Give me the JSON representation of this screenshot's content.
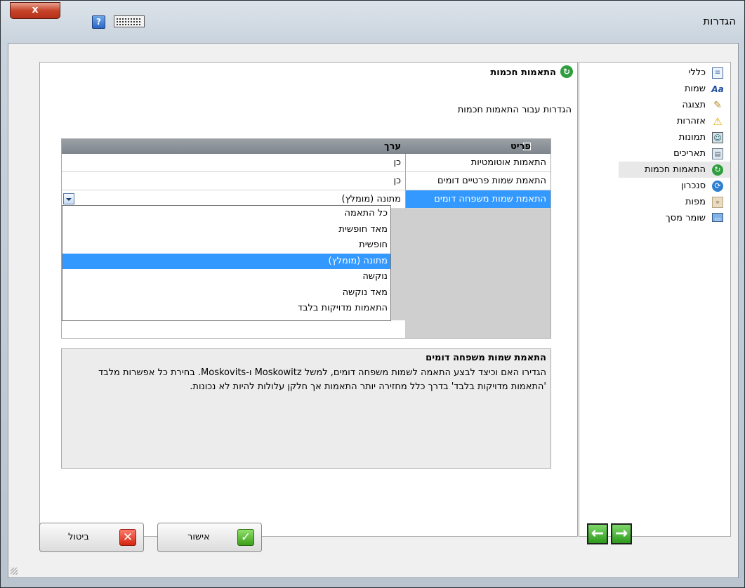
{
  "window": {
    "title": "הגדרות",
    "close_label": "x",
    "help_label": "?"
  },
  "nav": {
    "items": [
      {
        "label": "כללי",
        "icon": "document-list-icon"
      },
      {
        "label": "שמות",
        "icon": "font-aa-icon"
      },
      {
        "label": "תצוגה",
        "icon": "brush-icon"
      },
      {
        "label": "אזהרות",
        "icon": "warning-icon"
      },
      {
        "label": "תמונות",
        "icon": "picture-icon"
      },
      {
        "label": "תאריכים",
        "icon": "calendar-icon"
      },
      {
        "label": "התאמות חכמות",
        "icon": "smart-match-icon",
        "active": true
      },
      {
        "label": "סנכרון",
        "icon": "sync-icon"
      },
      {
        "label": "מפות",
        "icon": "map-icon"
      },
      {
        "label": "שומר מסך",
        "icon": "monitor-icon"
      }
    ]
  },
  "main": {
    "title": "התאמות חכמות",
    "subtitle": "הגדרות עבור התאמות חכמות",
    "grid": {
      "col_property": "פריט",
      "col_value": "ערך",
      "rows": [
        {
          "property": "התאמות אוטומטיות",
          "value": "כן"
        },
        {
          "property": "התאמת שמות פרטיים דומים",
          "value": "כן"
        },
        {
          "property": "התאמת שמות משפחה דומים",
          "value": "מתונה (מומלץ)"
        }
      ],
      "dropdown_options": [
        "כל התאמה",
        "מאד חופשית",
        "חופשית",
        "מתונה (מומלץ)",
        "נוקשה",
        "מאד נוקשה",
        "התאמות מדויקות בלבד"
      ],
      "selected_option": "מתונה (מומלץ)"
    },
    "description": {
      "title": "התאמת שמות משפחה דומים",
      "body": "הגדירו האם וכיצד לבצע התאמה לשמות משפחה דומים, למשל Moskowitz ו-Moskovits. בחירת כל אפשרות מלבד 'התאמות מדויקות בלבד' בדרך כלל מחזירה יותר התאמות אך חלקן עלולות להיות לא נכונות."
    }
  },
  "footer": {
    "cancel_label": "ביטול",
    "ok_label": "אישור"
  },
  "colors": {
    "selection": "#3399ff",
    "grid_header": "#8b9197",
    "accent_green": "#3c9e1a",
    "accent_red": "#d32712"
  }
}
